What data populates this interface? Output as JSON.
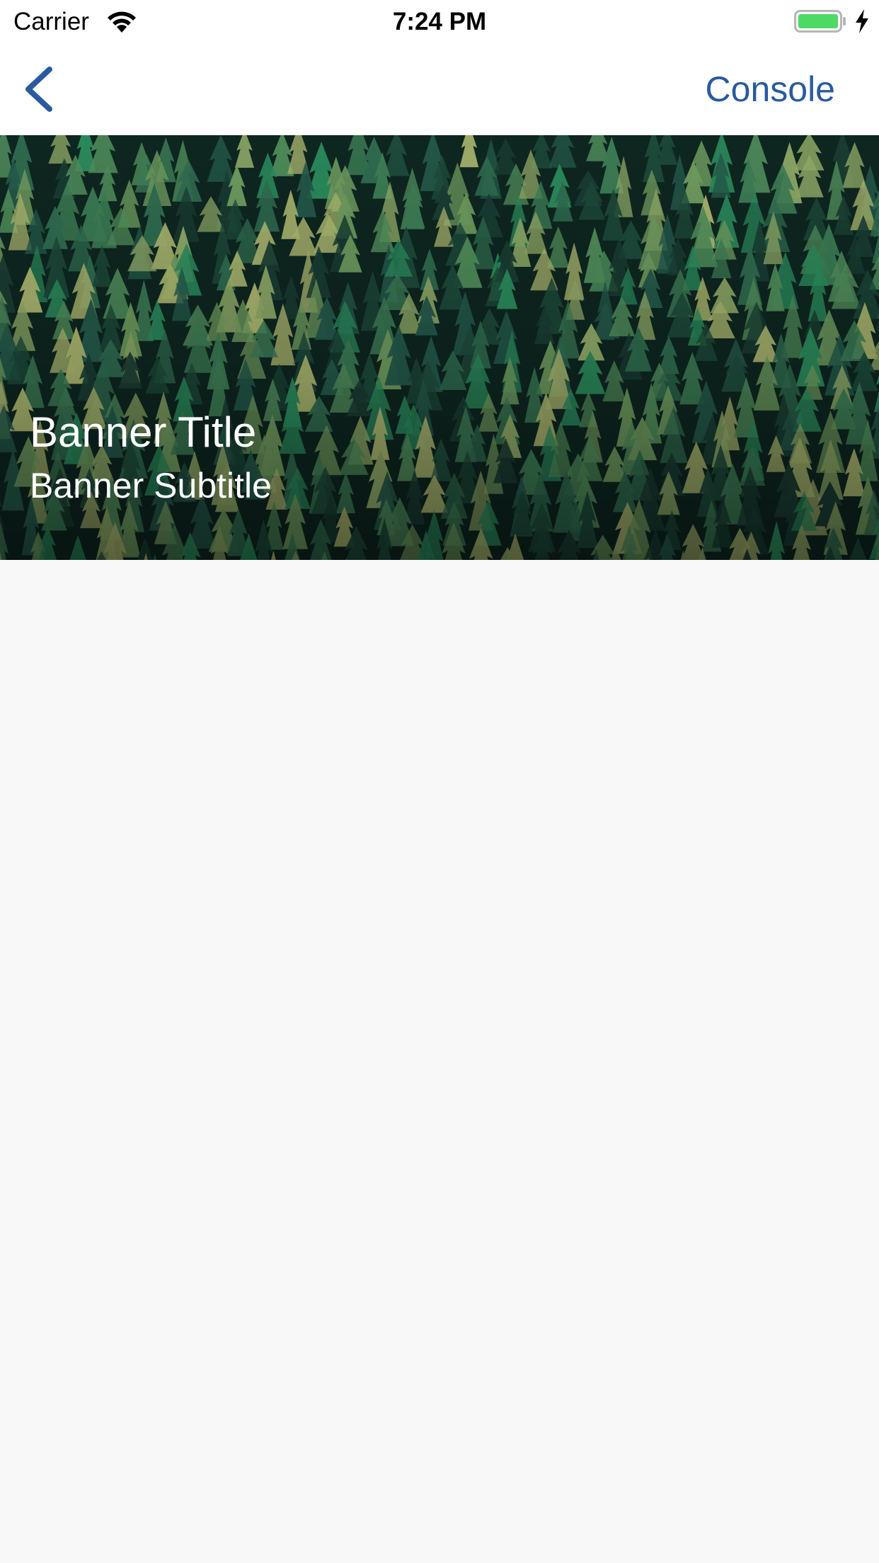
{
  "status_bar": {
    "carrier": "Carrier",
    "time": "7:24 PM",
    "wifi_icon": "wifi-icon",
    "battery_icon": "battery-icon",
    "battery_color": "#4cd964",
    "charging_icon": "charging-bolt-icon"
  },
  "nav": {
    "back_icon": "chevron-left-icon",
    "console_label": "Console",
    "tint_color": "#2a5a9e"
  },
  "banner": {
    "title": "Banner Title",
    "subtitle": "Banner Subtitle",
    "image": "pine-forest-pattern"
  }
}
